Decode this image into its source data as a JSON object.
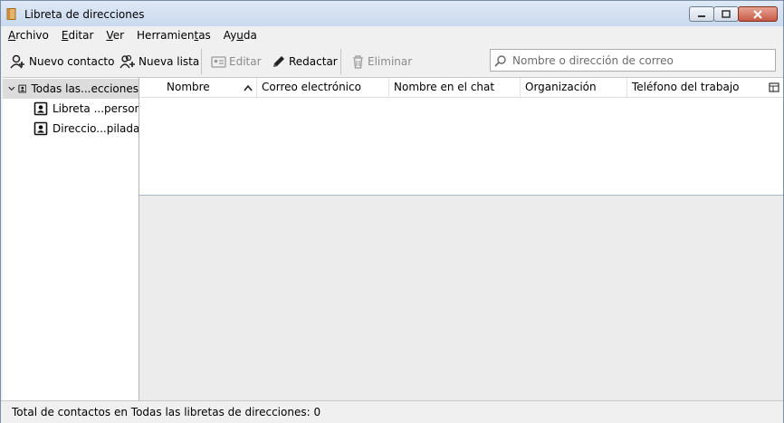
{
  "window": {
    "title": "Libreta de direcciones"
  },
  "menu": [
    {
      "label": "Archivo",
      "accel": "A",
      "rest": "rchivo"
    },
    {
      "label": "Editar",
      "accel": "E",
      "rest": "ditar"
    },
    {
      "label": "Ver",
      "accel": "V",
      "rest": "er"
    },
    {
      "label": "Herramientas",
      "pre": "Herramien",
      "accel": "t",
      "rest": "as"
    },
    {
      "label": "Ayuda",
      "pre": "Ay",
      "accel": "u",
      "rest": "da"
    }
  ],
  "toolbar": {
    "new_contact": "Nuevo contacto",
    "new_list": "Nueva lista",
    "edit": "Editar",
    "compose": "Redactar",
    "delete": "Eliminar",
    "search_placeholder": "Nombre o dirección de correo"
  },
  "tree": {
    "all": "Todas las...ecciones",
    "personal": "Libreta ...personal",
    "collected": "Direccio...piladas"
  },
  "columns": {
    "name": "Nombre",
    "email": "Correo electrónico",
    "chat": "Nombre en el chat",
    "org": "Organización",
    "phone": "Teléfono del trabajo"
  },
  "status": "Total de contactos en Todas las libretas de direcciones: 0",
  "colors": {
    "titlebar": "#c9d9ee",
    "close_button": "#c75a46",
    "selected_row": "#dcdcdc"
  }
}
